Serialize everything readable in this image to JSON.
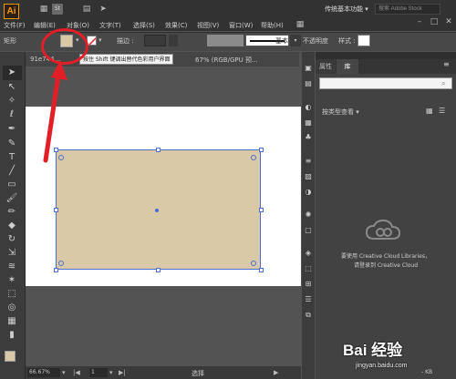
{
  "app": {
    "logo_text": "Ai",
    "bridge_label": "St"
  },
  "menu": [
    {
      "label": "文件(F)"
    },
    {
      "label": "编辑(E)"
    },
    {
      "label": "对象(O)"
    },
    {
      "label": "文字(T)"
    },
    {
      "label": "选择(S)"
    },
    {
      "label": "效果(C)"
    },
    {
      "label": "视图(V)"
    },
    {
      "label": "窗口(W)"
    },
    {
      "label": "帮助(H)"
    }
  ],
  "workspace": {
    "label": "传统基本功能 ▾"
  },
  "stock_search": {
    "placeholder": "搜索 Adobe Stock"
  },
  "control_bar": {
    "shape_label": "矩形",
    "stroke_label": "描边 :",
    "line_style": "基本",
    "opacity_label": "不透明度",
    "style_label": "样式 :",
    "fill_color": "#dac9a6"
  },
  "tooltip": {
    "text": "按住 Shift 键调出替代色彩用户界面"
  },
  "document_tab": {
    "left_text": "91e744...",
    "right_text": "67% (RGB/GPU 预..."
  },
  "status_bar": {
    "zoom": "66.67%",
    "page": "1",
    "mode": "选择"
  },
  "right_panel": {
    "tab_properties": "属性",
    "tab_libraries": "库",
    "filter_label": "按类型查看  ▾",
    "message_line1": "要使用 Creative Cloud Libraries，",
    "message_line2": "请登录到 Creative Cloud",
    "panel_size": "- KB"
  },
  "watermark": {
    "text": "Bai 经验",
    "url": "jingyan.baidu.com"
  },
  "colors": {
    "annotation": "#e21f26",
    "selection": "#4a6ed1",
    "fill": "#dac9a6"
  }
}
